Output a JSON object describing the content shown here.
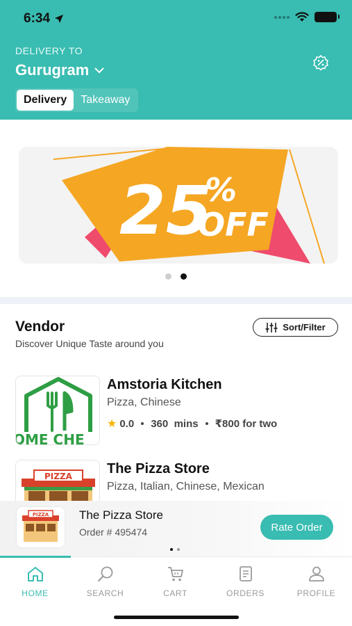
{
  "status": {
    "time": "6:34"
  },
  "header": {
    "delivery_label": "DELIVERY TO",
    "city": "Gurugram",
    "modes": [
      {
        "label": "Delivery",
        "active": true
      },
      {
        "label": "Takeaway",
        "active": false
      }
    ]
  },
  "banner": {
    "text_big": "25",
    "text_pct": "%",
    "text_off": "OFF",
    "dots_total": 2,
    "dot_active": 2
  },
  "vendors_section": {
    "title": "Vendor",
    "subtitle": "Discover Unique Taste around you",
    "sort_label": "Sort/Filter",
    "items": [
      {
        "name": "Amstoria Kitchen",
        "cuisine": "Pizza, Chinese",
        "rating": "0.0",
        "time": "360  mins",
        "price": "₹800 for two",
        "thumb_text": "OME CHE"
      },
      {
        "name": "The Pizza Store",
        "cuisine": "Pizza, Italian, Chinese, Mexican",
        "thumb_text": "PIZZA"
      }
    ]
  },
  "order_card": {
    "store": "The Pizza Store",
    "order_no": "Order # 495474",
    "rate_label": "Rate Order",
    "thumb_text": "PIZZA"
  },
  "tabs": [
    {
      "label": "HOME",
      "icon": "home-icon",
      "active": true
    },
    {
      "label": "SEARCH",
      "icon": "search-icon",
      "active": false
    },
    {
      "label": "CART",
      "icon": "cart-icon",
      "active": false
    },
    {
      "label": "ORDERS",
      "icon": "orders-icon",
      "active": false
    },
    {
      "label": "PROFILE",
      "icon": "profile-icon",
      "active": false
    }
  ],
  "colors": {
    "brand": "#39bcb1",
    "banner_orange": "#f5a623",
    "banner_pink": "#ef4b6c",
    "vendor_green": "#2e9e44"
  }
}
